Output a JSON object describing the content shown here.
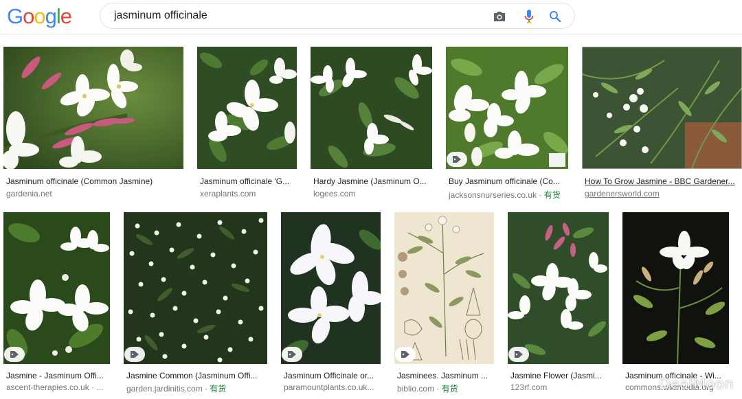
{
  "logo": {
    "text": "Google"
  },
  "search": {
    "query": "jasminum officinale"
  },
  "icons": {
    "camera": "camera-icon",
    "mic": "microphone-icon",
    "search": "search-icon",
    "tag": "price-tag-icon"
  },
  "colors": {
    "in_stock": "#188038",
    "source": "#70757a",
    "title": "#202124"
  },
  "results": [
    {
      "title": "Jasminum officinale (Common Jasmine)",
      "source": "gardenia.net",
      "stock": ""
    },
    {
      "title": "Jasminum officinale 'G...",
      "source": "xeraplants.com",
      "stock": ""
    },
    {
      "title": "Hardy Jasmine (Jasminum O...",
      "source": "logees.com",
      "stock": ""
    },
    {
      "title": "Buy Jasminum officinale (Co...",
      "source": "jacksonsnurseries.co.uk",
      "stock": "有货"
    },
    {
      "title": "How To Grow Jasmine - BBC Gardener...",
      "source": "gardenersworld.com",
      "stock": ""
    },
    {
      "title": "Jasmine - Jasminum Offi...",
      "source": "ascent-therapies.co.uk · ...",
      "stock": ""
    },
    {
      "title": "Jasmine Common (Jasminum Offi...",
      "source": "garden.jardinitis.com",
      "stock": "有货"
    },
    {
      "title": "Jasminum Officinale or...",
      "source": "paramountplants.co.uk...",
      "stock": ""
    },
    {
      "title": "Jasminees. Jasminum ...",
      "source": "biblio.com",
      "stock": "有货"
    },
    {
      "title": "Jasmine Flower (Jasmi...",
      "source": "123rf.com",
      "stock": ""
    },
    {
      "title": "Jasminum officinale - Wi...",
      "source": "commons.wikimedia.org",
      "stock": ""
    }
  ],
  "watermark": {
    "text": "DealMoon"
  }
}
